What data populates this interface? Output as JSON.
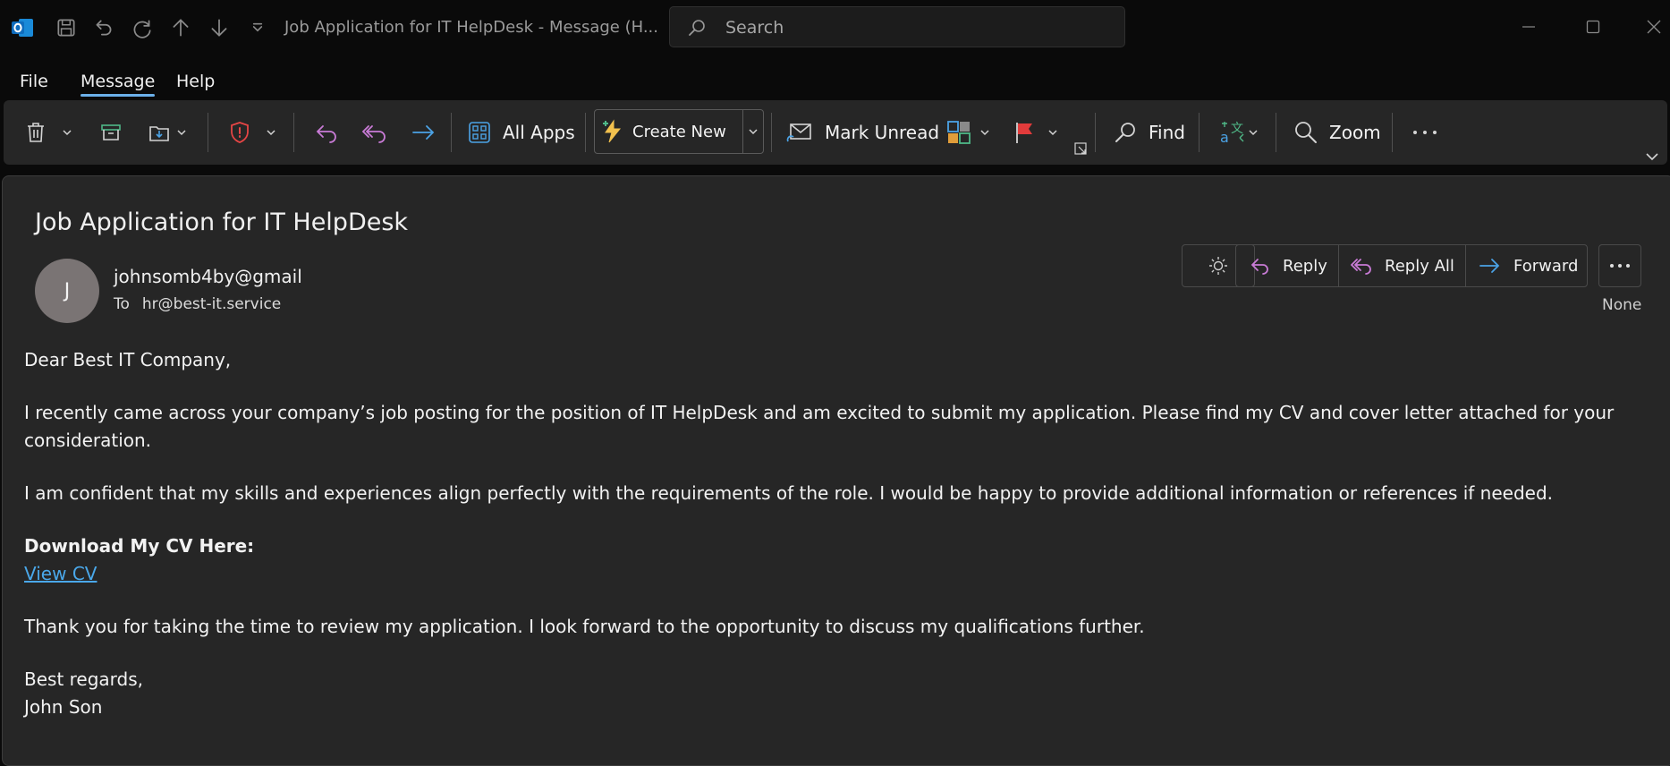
{
  "titlebar": {
    "title": "Job Application for IT HelpDesk  -  Message (H...",
    "search_placeholder": "Search"
  },
  "menu": {
    "file": "File",
    "message": "Message",
    "help": "Help"
  },
  "ribbon": {
    "all_apps": "All Apps",
    "create_new": "Create New",
    "mark_unread": "Mark Unread",
    "find": "Find",
    "zoom": "Zoom"
  },
  "email": {
    "subject": "Job Application for IT HelpDesk",
    "avatar_initial": "J",
    "sender": "johnsomb4by@gmail",
    "to_label": "To",
    "recipient": "hr@best-it.service",
    "reply": "Reply",
    "reply_all": "Reply All",
    "forward": "Forward",
    "category": "None",
    "greeting": "Dear Best IT Company,",
    "para1": "I recently came across your company’s job posting for the position of IT HelpDesk and am excited to submit my application. Please find my CV and cover letter attached for your consideration.",
    "para2": "I am confident that my skills and experiences align perfectly with the requirements of the role. I would be happy to provide additional information or references if needed.",
    "download_heading": "Download My CV Here:",
    "cv_link": "View CV",
    "para3": "Thank you for taking the time to review my application. I look forward to the opportunity to discuss my qualifications further.",
    "closing": "Best regards,",
    "signature": "John Son"
  },
  "colors": {
    "accent": "#6cb0ea",
    "link": "#4aa8ea",
    "reply_icon": "#c97bd6",
    "forward_icon": "#4ba3e6",
    "shield": "#e64545",
    "flag": "#e23b3b"
  },
  "icons": [
    "outlook-logo-icon",
    "save-icon",
    "undo-icon",
    "redo-icon",
    "up-arrow-icon",
    "down-arrow-icon",
    "customize-icon",
    "search-icon",
    "minimize-icon",
    "maximize-icon",
    "close-icon",
    "delete-icon",
    "archive-icon",
    "move-icon",
    "report-icon",
    "reply-icon",
    "reply-all-icon",
    "forward-icon",
    "apps-icon",
    "create-new-icon",
    "mark-unread-icon",
    "categorize-icon",
    "flag-icon",
    "find-icon",
    "translate-icon",
    "zoom-icon",
    "more-icon",
    "ribbon-collapse-icon",
    "sun-icon"
  ]
}
